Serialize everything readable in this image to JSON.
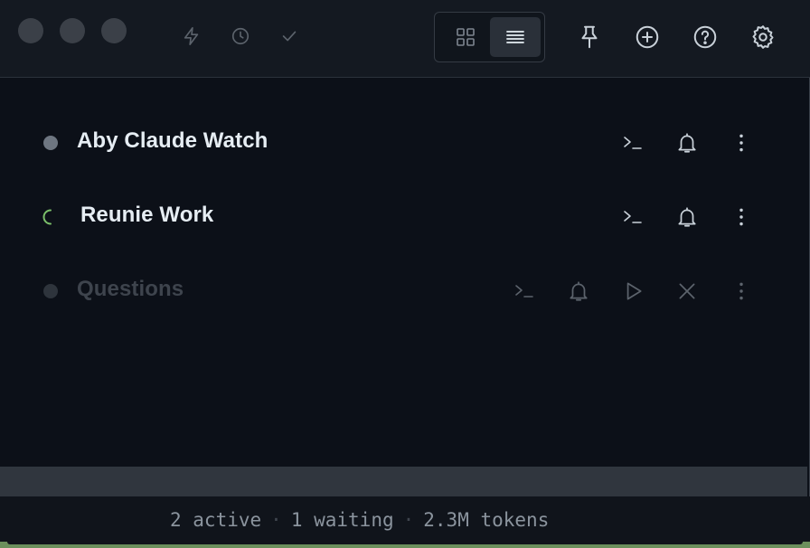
{
  "toolbar": {
    "left_icons": [
      "lightning-icon",
      "clock-icon",
      "check-icon"
    ],
    "view_toggle": {
      "options": [
        "grid-view",
        "list-view"
      ],
      "selected": "list-view"
    },
    "right_icons": [
      "pin-icon",
      "add-circle-icon",
      "help-icon",
      "settings-gear-icon"
    ]
  },
  "sessions": [
    {
      "title": "Aby Claude Watch",
      "status": "idle",
      "actions": [
        "terminal",
        "bell",
        "more"
      ]
    },
    {
      "title": "Reunie Work",
      "status": "running",
      "actions": [
        "terminal",
        "bell",
        "more"
      ]
    },
    {
      "title": "Questions",
      "status": "inactive",
      "actions": [
        "terminal",
        "bell",
        "play",
        "close",
        "more"
      ]
    }
  ],
  "status": {
    "active": "2 active",
    "waiting": "1 waiting",
    "tokens": "2.3M tokens",
    "separator": "·"
  },
  "colors": {
    "background": "#0c1018",
    "titlebar": "#141921",
    "spinner": "#7bbf6a",
    "accent_strip": "#6b8f5c"
  }
}
